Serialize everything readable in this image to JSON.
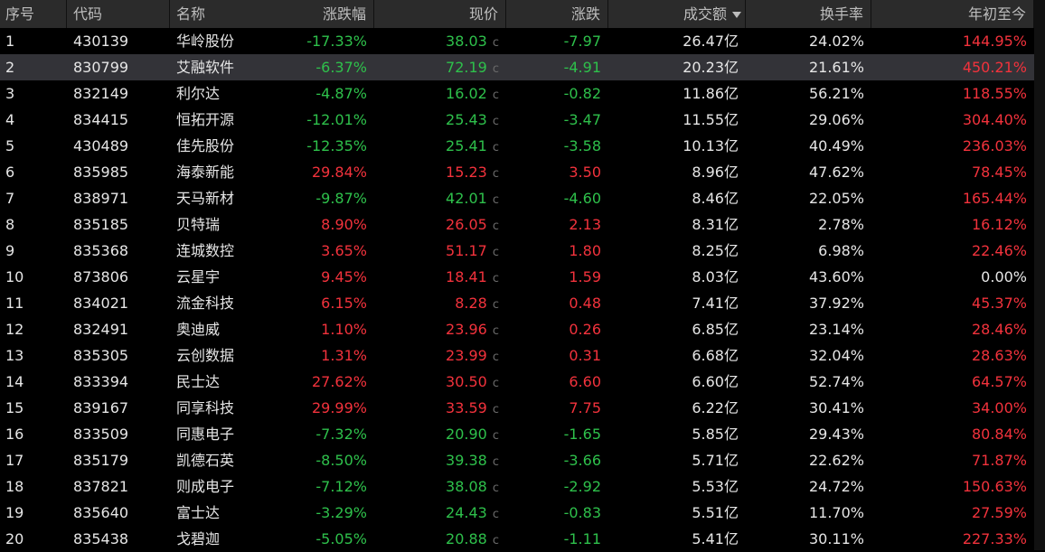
{
  "header": {
    "idx": "序号",
    "code": "代码",
    "name": "名称",
    "pct": "涨跌幅",
    "price": "现价",
    "chg": "涨跌",
    "amount": "成交额",
    "turnover": "换手率",
    "ytd": "年初至今"
  },
  "price_suffix": "c",
  "selected_row": 2,
  "colors": {
    "up": "#f2323c",
    "down": "#2ec04b",
    "neutral": "#e6e6e6",
    "header_bg": "#2b2b2b",
    "selected_bg": "#333338"
  },
  "rows": [
    {
      "idx": "1",
      "code": "430139",
      "name": "华岭股份",
      "pct": "-17.33%",
      "price": "38.03",
      "chg": "-7.97",
      "amount": "26.47亿",
      "turnover": "24.02%",
      "ytd": "144.95%"
    },
    {
      "idx": "2",
      "code": "830799",
      "name": "艾融软件",
      "pct": "-6.37%",
      "price": "72.19",
      "chg": "-4.91",
      "amount": "20.23亿",
      "turnover": "21.61%",
      "ytd": "450.21%"
    },
    {
      "idx": "3",
      "code": "832149",
      "name": "利尔达",
      "pct": "-4.87%",
      "price": "16.02",
      "chg": "-0.82",
      "amount": "11.86亿",
      "turnover": "56.21%",
      "ytd": "118.55%"
    },
    {
      "idx": "4",
      "code": "834415",
      "name": "恒拓开源",
      "pct": "-12.01%",
      "price": "25.43",
      "chg": "-3.47",
      "amount": "11.55亿",
      "turnover": "29.06%",
      "ytd": "304.40%"
    },
    {
      "idx": "5",
      "code": "430489",
      "name": "佳先股份",
      "pct": "-12.35%",
      "price": "25.41",
      "chg": "-3.58",
      "amount": "10.13亿",
      "turnover": "40.49%",
      "ytd": "236.03%"
    },
    {
      "idx": "6",
      "code": "835985",
      "name": "海泰新能",
      "pct": "29.84%",
      "price": "15.23",
      "chg": "3.50",
      "amount": "8.96亿",
      "turnover": "47.62%",
      "ytd": "78.45%"
    },
    {
      "idx": "7",
      "code": "838971",
      "name": "天马新材",
      "pct": "-9.87%",
      "price": "42.01",
      "chg": "-4.60",
      "amount": "8.46亿",
      "turnover": "22.05%",
      "ytd": "165.44%"
    },
    {
      "idx": "8",
      "code": "835185",
      "name": "贝特瑞",
      "pct": "8.90%",
      "price": "26.05",
      "chg": "2.13",
      "amount": "8.31亿",
      "turnover": "2.78%",
      "ytd": "16.12%"
    },
    {
      "idx": "9",
      "code": "835368",
      "name": "连城数控",
      "pct": "3.65%",
      "price": "51.17",
      "chg": "1.80",
      "amount": "8.25亿",
      "turnover": "6.98%",
      "ytd": "22.46%"
    },
    {
      "idx": "10",
      "code": "873806",
      "name": "云星宇",
      "pct": "9.45%",
      "price": "18.41",
      "chg": "1.59",
      "amount": "8.03亿",
      "turnover": "43.60%",
      "ytd": "0.00%"
    },
    {
      "idx": "11",
      "code": "834021",
      "name": "流金科技",
      "pct": "6.15%",
      "price": "8.28",
      "chg": "0.48",
      "amount": "7.41亿",
      "turnover": "37.92%",
      "ytd": "45.37%"
    },
    {
      "idx": "12",
      "code": "832491",
      "name": "奥迪威",
      "pct": "1.10%",
      "price": "23.96",
      "chg": "0.26",
      "amount": "6.85亿",
      "turnover": "23.14%",
      "ytd": "28.46%"
    },
    {
      "idx": "13",
      "code": "835305",
      "name": "云创数据",
      "pct": "1.31%",
      "price": "23.99",
      "chg": "0.31",
      "amount": "6.68亿",
      "turnover": "32.04%",
      "ytd": "28.63%"
    },
    {
      "idx": "14",
      "code": "833394",
      "name": "民士达",
      "pct": "27.62%",
      "price": "30.50",
      "chg": "6.60",
      "amount": "6.60亿",
      "turnover": "52.74%",
      "ytd": "64.57%"
    },
    {
      "idx": "15",
      "code": "839167",
      "name": "同享科技",
      "pct": "29.99%",
      "price": "33.59",
      "chg": "7.75",
      "amount": "6.22亿",
      "turnover": "30.41%",
      "ytd": "34.00%"
    },
    {
      "idx": "16",
      "code": "833509",
      "name": "同惠电子",
      "pct": "-7.32%",
      "price": "20.90",
      "chg": "-1.65",
      "amount": "5.85亿",
      "turnover": "29.43%",
      "ytd": "80.84%"
    },
    {
      "idx": "17",
      "code": "835179",
      "name": "凯德石英",
      "pct": "-8.50%",
      "price": "39.38",
      "chg": "-3.66",
      "amount": "5.71亿",
      "turnover": "22.62%",
      "ytd": "71.87%"
    },
    {
      "idx": "18",
      "code": "837821",
      "name": "则成电子",
      "pct": "-7.12%",
      "price": "38.08",
      "chg": "-2.92",
      "amount": "5.53亿",
      "turnover": "24.72%",
      "ytd": "150.63%"
    },
    {
      "idx": "19",
      "code": "835640",
      "name": "富士达",
      "pct": "-3.29%",
      "price": "24.43",
      "chg": "-0.83",
      "amount": "5.51亿",
      "turnover": "11.70%",
      "ytd": "27.59%"
    },
    {
      "idx": "20",
      "code": "835438",
      "name": "戈碧迦",
      "pct": "-5.05%",
      "price": "20.88",
      "chg": "-1.11",
      "amount": "5.41亿",
      "turnover": "30.11%",
      "ytd": "227.33%"
    }
  ]
}
